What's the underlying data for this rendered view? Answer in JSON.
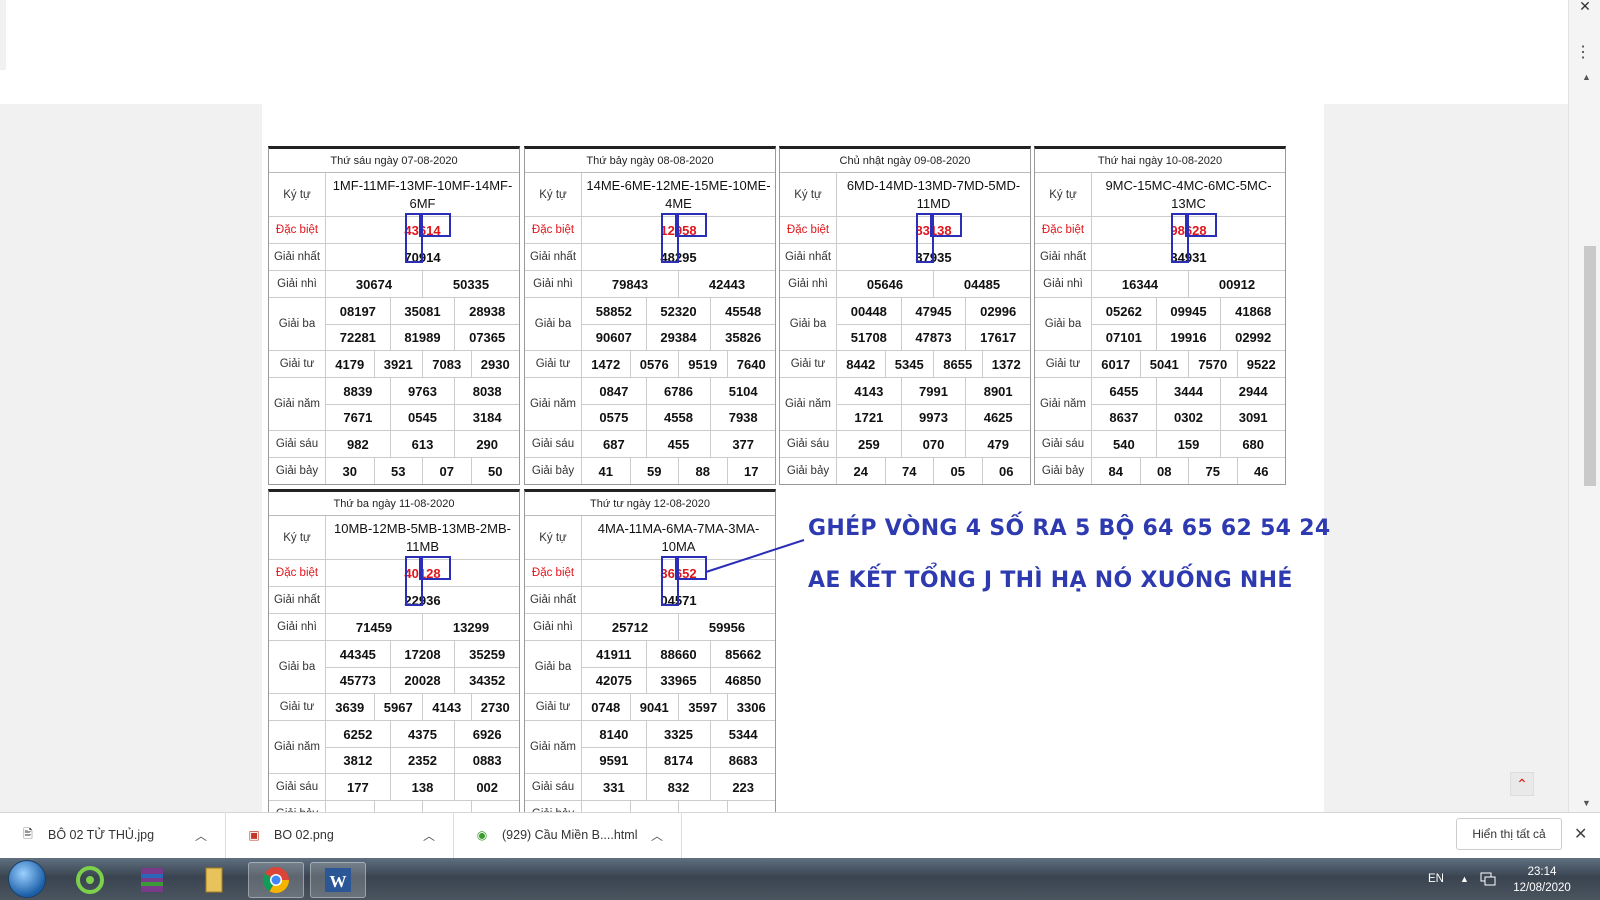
{
  "labels": {
    "kytu": "Ký tự",
    "dacbiet": "Đặc biệt",
    "nhat": "Giải nhất",
    "nhi": "Giải nhì",
    "ba": "Giải ba",
    "tu": "Giải tư",
    "nam": "Giải năm",
    "sau": "Giải sáu",
    "bay": "Giải bảy"
  },
  "cards": [
    {
      "date": "Thứ sáu ngày 07-08-2020",
      "kytu": "1MF-11MF-13MF-10MF-14MF-6MF",
      "db": "43614",
      "nhat": "70914",
      "nhi": [
        "30674",
        "50335"
      ],
      "ba": [
        [
          "08197",
          "35081",
          "28938"
        ],
        [
          "72281",
          "81989",
          "07365"
        ]
      ],
      "tu": [
        "4179",
        "3921",
        "7083",
        "2930"
      ],
      "nam": [
        [
          "8839",
          "9763",
          "8038"
        ],
        [
          "7671",
          "0545",
          "3184"
        ]
      ],
      "sau": [
        "982",
        "613",
        "290"
      ],
      "bay": [
        "30",
        "53",
        "07",
        "50"
      ]
    },
    {
      "date": "Thứ bảy ngày 08-08-2020",
      "kytu": "14ME-6ME-12ME-15ME-10ME-4ME",
      "db": "12958",
      "nhat": "48295",
      "nhi": [
        "79843",
        "42443"
      ],
      "ba": [
        [
          "58852",
          "52320",
          "45548"
        ],
        [
          "90607",
          "29384",
          "35826"
        ]
      ],
      "tu": [
        "1472",
        "0576",
        "9519",
        "7640"
      ],
      "nam": [
        [
          "0847",
          "6786",
          "5104"
        ],
        [
          "0575",
          "4558",
          "7938"
        ]
      ],
      "sau": [
        "687",
        "455",
        "377"
      ],
      "bay": [
        "41",
        "59",
        "88",
        "17"
      ]
    },
    {
      "date": "Chủ nhật ngày 09-08-2020",
      "kytu": "6MD-14MD-13MD-7MD-5MD-11MD",
      "db": "83138",
      "nhat": "37935",
      "nhi": [
        "05646",
        "04485"
      ],
      "ba": [
        [
          "00448",
          "47945",
          "02996"
        ],
        [
          "51708",
          "47873",
          "17617"
        ]
      ],
      "tu": [
        "8442",
        "5345",
        "8655",
        "1372"
      ],
      "nam": [
        [
          "4143",
          "7991",
          "8901"
        ],
        [
          "1721",
          "9973",
          "4625"
        ]
      ],
      "sau": [
        "259",
        "070",
        "479"
      ],
      "bay": [
        "24",
        "74",
        "05",
        "06"
      ]
    },
    {
      "date": "Thứ hai ngày 10-08-2020",
      "kytu": "9MC-15MC-4MC-6MC-5MC-13MC",
      "db": "98628",
      "nhat": "34931",
      "nhi": [
        "16344",
        "00912"
      ],
      "ba": [
        [
          "05262",
          "09945",
          "41868"
        ],
        [
          "07101",
          "19916",
          "02992"
        ]
      ],
      "tu": [
        "6017",
        "5041",
        "7570",
        "9522"
      ],
      "nam": [
        [
          "6455",
          "3444",
          "2944"
        ],
        [
          "8637",
          "0302",
          "3091"
        ]
      ],
      "sau": [
        "540",
        "159",
        "680"
      ],
      "bay": [
        "84",
        "08",
        "75",
        "46"
      ]
    },
    {
      "date": "Thứ ba ngày 11-08-2020",
      "kytu": "10MB-12MB-5MB-13MB-2MB-11MB",
      "db": "40128",
      "nhat": "22936",
      "nhi": [
        "71459",
        "13299"
      ],
      "ba": [
        [
          "44345",
          "17208",
          "35259"
        ],
        [
          "45773",
          "20028",
          "34352"
        ]
      ],
      "tu": [
        "3639",
        "5967",
        "4143",
        "2730"
      ],
      "nam": [
        [
          "6252",
          "4375",
          "6926"
        ],
        [
          "3812",
          "2352",
          "0883"
        ]
      ],
      "sau": [
        "177",
        "138",
        "002"
      ],
      "bay": [
        "",
        "",
        "",
        ""
      ]
    },
    {
      "date": "Thứ tư ngày 12-08-2020",
      "kytu": "4MA-11MA-6MA-7MA-3MA-10MA",
      "db": "36652",
      "nhat": "04571",
      "nhi": [
        "25712",
        "59956"
      ],
      "ba": [
        [
          "41911",
          "88660",
          "85662"
        ],
        [
          "42075",
          "33965",
          "46850"
        ]
      ],
      "tu": [
        "0748",
        "9041",
        "3597",
        "3306"
      ],
      "nam": [
        [
          "8140",
          "3325",
          "5344"
        ],
        [
          "9591",
          "8174",
          "8683"
        ]
      ],
      "sau": [
        "331",
        "832",
        "223"
      ],
      "bay": [
        "",
        "",
        "",
        ""
      ]
    }
  ],
  "annotation": {
    "line1": "GHÉP VÒNG 4 SỐ RA 5 BỘ 64 65 62 54 24",
    "line2": "AE KẾT TỔNG J THÌ HẠ NÓ XUỐNG NHÉ"
  },
  "downloads": {
    "items": [
      {
        "name": "BÔ 02 TỬ THỦ.jpg"
      },
      {
        "name": "BO 02.png"
      },
      {
        "name": "(929) Cầu Miền B....html"
      }
    ],
    "show_all": "Hiển thị tất cả"
  },
  "taskbar": {
    "lang": "EN",
    "time": "23:14",
    "date": "12/08/2020"
  },
  "colors": {
    "highlight": "#2b2fb8",
    "red": "#e0161b",
    "annotation": "#2e3ab0"
  }
}
